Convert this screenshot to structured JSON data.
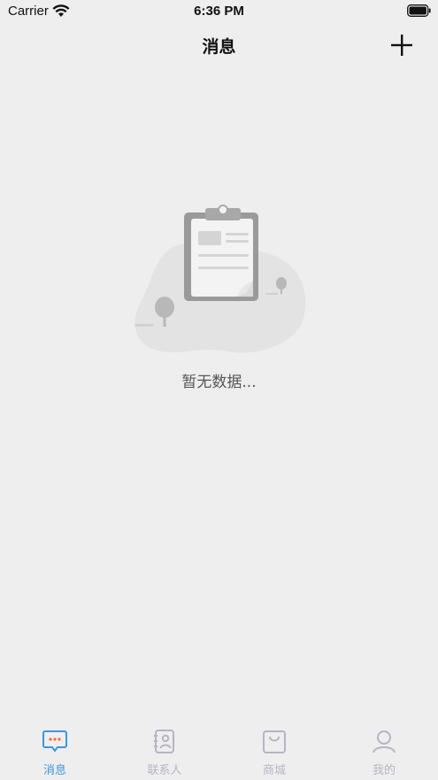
{
  "status_bar": {
    "carrier": "Carrier",
    "time": "6:36 PM"
  },
  "nav": {
    "title": "消息",
    "add_icon": "plus-icon"
  },
  "empty_state": {
    "icon": "clipboard-illustration",
    "text": "暂无数据..."
  },
  "tabs": [
    {
      "label": "消息",
      "icon": "message-icon",
      "active": true
    },
    {
      "label": "联系人",
      "icon": "contacts-icon",
      "active": false
    },
    {
      "label": "商城",
      "icon": "shopping-bag-icon",
      "active": false
    },
    {
      "label": "我的",
      "icon": "profile-icon",
      "active": false
    }
  ],
  "colors": {
    "background": "#eeeeee",
    "active_tab": "#3f95e0",
    "active_tab_dots": "#f26b3a",
    "inactive_tab": "#b7b4c4"
  }
}
